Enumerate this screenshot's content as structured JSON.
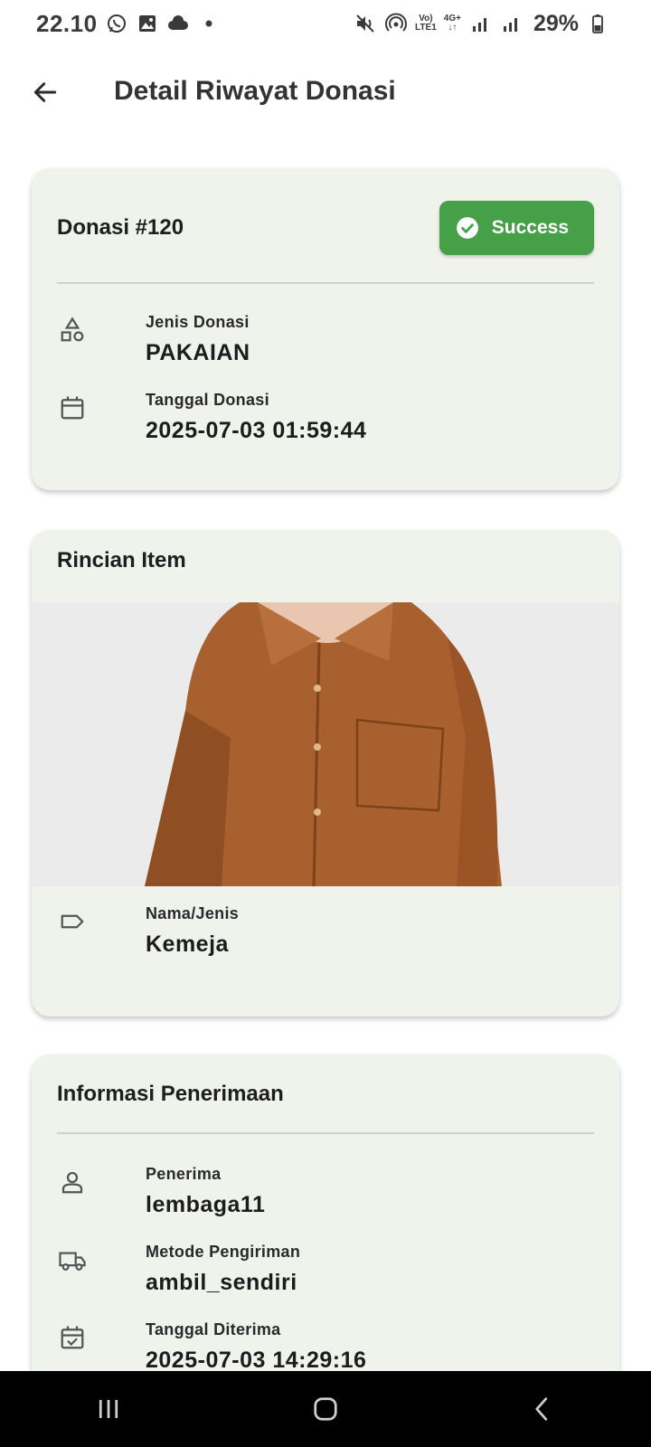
{
  "status_bar": {
    "time": "22.10",
    "network_top": "Vo)",
    "network_bottom": "LTE1",
    "data_top": "4G+",
    "battery": "29%",
    "icons": [
      "whatsapp-icon",
      "gallery-icon",
      "cloud-icon",
      "dot-icon",
      "mute-icon",
      "hotspot-icon",
      "signal-icon",
      "battery-icon"
    ]
  },
  "app_bar": {
    "title": "Detail Riwayat Donasi",
    "back_icon": "arrow-left-icon"
  },
  "donation_card": {
    "title": "Donasi #120",
    "status": "Success",
    "status_color": "#45a048",
    "type_label": "Jenis Donasi",
    "type_value": "PAKAIAN",
    "date_label": "Tanggal Donasi",
    "date_value": "2025-07-03 01:59:44"
  },
  "item_card": {
    "title": "Rincian Item",
    "image_subject": "brown shirt photo",
    "name_label": "Nama/Jenis",
    "name_value": "Kemeja"
  },
  "receipt_card": {
    "title": "Informasi Penerimaan",
    "receiver_label": "Penerima",
    "receiver_value": "lembaga11",
    "shipping_label": "Metode Pengiriman",
    "shipping_value": "ambil_sendiri",
    "received_label": "Tanggal Diterima",
    "received_value": "2025-07-03 14:29:16"
  },
  "theme": {
    "card_bg": "#f0f2ec",
    "accent_green": "#45a048"
  }
}
